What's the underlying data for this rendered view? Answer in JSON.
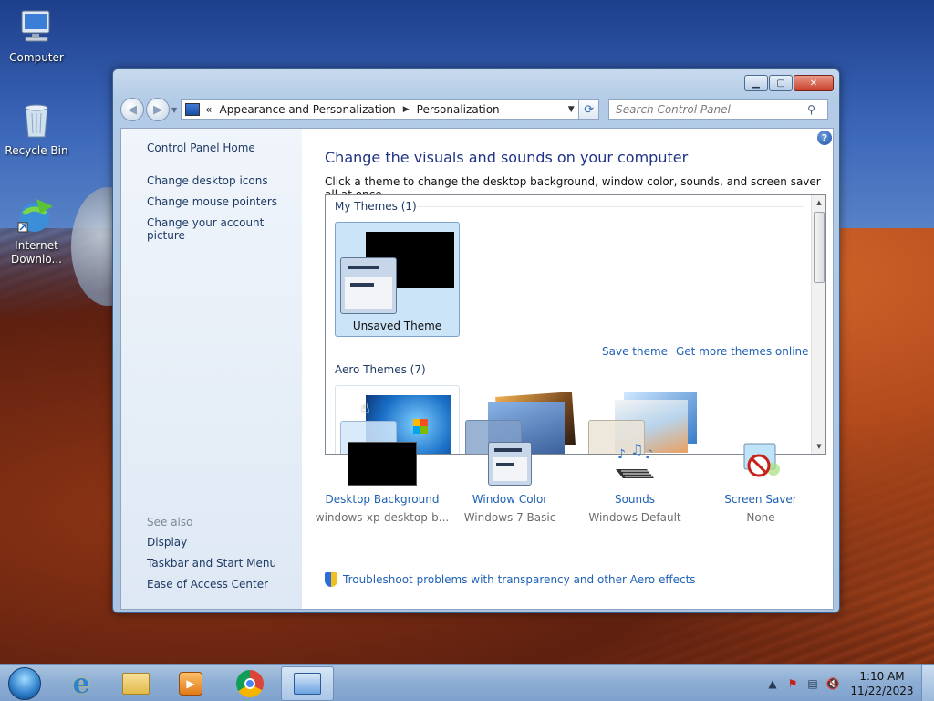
{
  "desktop": {
    "icons": [
      {
        "label": "Computer",
        "icon": "computer-icon"
      },
      {
        "label": "Recycle Bin",
        "icon": "recycle-bin-icon"
      },
      {
        "label": "Internet Downlo...",
        "icon": "internet-download-manager-icon"
      }
    ]
  },
  "window": {
    "address": {
      "prefix": "«",
      "crumbs": [
        "Appearance and Personalization",
        "Personalization"
      ]
    },
    "search": {
      "placeholder": "Search Control Panel"
    },
    "sidebar": {
      "home": "Control Panel Home",
      "links": [
        "Change desktop icons",
        "Change mouse pointers",
        "Change your account picture"
      ],
      "see_also_label": "See also",
      "see_also": [
        "Display",
        "Taskbar and Start Menu",
        "Ease of Access Center"
      ]
    },
    "main": {
      "heading": "Change the visuals and sounds on your computer",
      "subheading": "Click a theme to change the desktop background, window color, sounds, and screen saver all at once.",
      "my_themes_label": "My Themes (1)",
      "unsaved_theme_name": "Unsaved Theme",
      "save_theme": "Save theme",
      "get_more": "Get more themes online",
      "aero_themes_label": "Aero Themes (7)",
      "options": [
        {
          "label": "Desktop Background",
          "value": "windows-xp-desktop-b..."
        },
        {
          "label": "Window Color",
          "value": "Windows 7 Basic"
        },
        {
          "label": "Sounds",
          "value": "Windows Default"
        },
        {
          "label": "Screen Saver",
          "value": "None"
        }
      ],
      "troubleshoot": "Troubleshoot problems with transparency and other Aero effects"
    }
  },
  "taskbar": {
    "clock_time": "1:10 AM",
    "clock_date": "11/22/2023",
    "pinned": [
      "internet-explorer-icon",
      "windows-explorer-icon",
      "media-player-icon",
      "chrome-icon",
      "control-panel-icon"
    ]
  },
  "colors": {
    "link": "#1f61b4",
    "heading": "#1e3287",
    "selection": "#cce4f7"
  }
}
